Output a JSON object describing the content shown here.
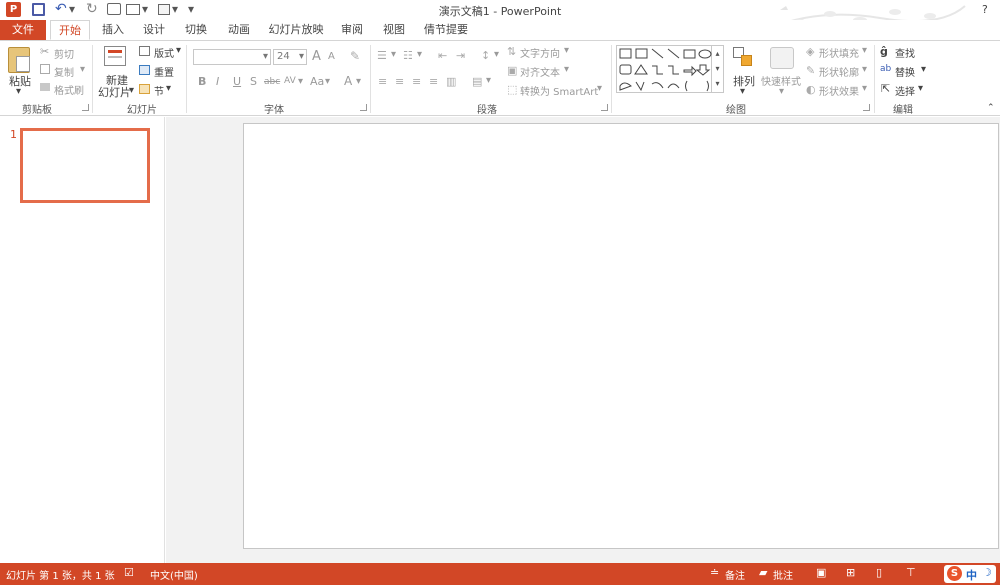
{
  "window": {
    "title": "演示文稿1 - PowerPoint",
    "help": "?"
  },
  "quick_access": {
    "undo_dropdown": "▾",
    "customize": "▾"
  },
  "tabs": [
    {
      "label": "文件"
    },
    {
      "label": "开始"
    },
    {
      "label": "插入"
    },
    {
      "label": "设计"
    },
    {
      "label": "切换"
    },
    {
      "label": "动画"
    },
    {
      "label": "幻灯片放映"
    },
    {
      "label": "审阅"
    },
    {
      "label": "视图"
    },
    {
      "label": "倩节提要"
    }
  ],
  "ribbon": {
    "clipboard": {
      "paste": "粘贴",
      "cut": "剪切",
      "copy": "复制",
      "format_painter": "格式刷",
      "label": "剪贴板"
    },
    "slides": {
      "new_slide": "新建",
      "new_slide2": "幻灯片",
      "layout": "版式",
      "reset": "重置",
      "section": "节",
      "label": "幻灯片"
    },
    "font": {
      "size": "24",
      "grow": "A",
      "shrink": "A",
      "bold": "B",
      "italic": "I",
      "underline": "U",
      "shadow": "S",
      "strike": "abc",
      "spacing": "AV",
      "case": "Aa",
      "color": "A",
      "label": "字体"
    },
    "paragraph": {
      "text_direction": "文字方向",
      "align_text": "对齐文本",
      "smartart": "转换为 SmartArt",
      "label": "段落"
    },
    "drawing": {
      "arrange": "排列",
      "quick_styles": "快速样式",
      "fill": "形状填充",
      "outline": "形状轮廓",
      "effects": "形状效果",
      "label": "绘图"
    },
    "editing": {
      "find": "查找",
      "replace": "替换",
      "select": "选择",
      "label": "编辑"
    }
  },
  "thumbnails": [
    {
      "number": "1"
    }
  ],
  "status": {
    "slide_info": "幻灯片 第 1 张，共 1 张",
    "language": "中文(中国)",
    "notes": "备注",
    "comments": "批注",
    "ime": "中"
  },
  "colors": {
    "accent": "#d24726",
    "thumb_border": "#e46c4a"
  }
}
